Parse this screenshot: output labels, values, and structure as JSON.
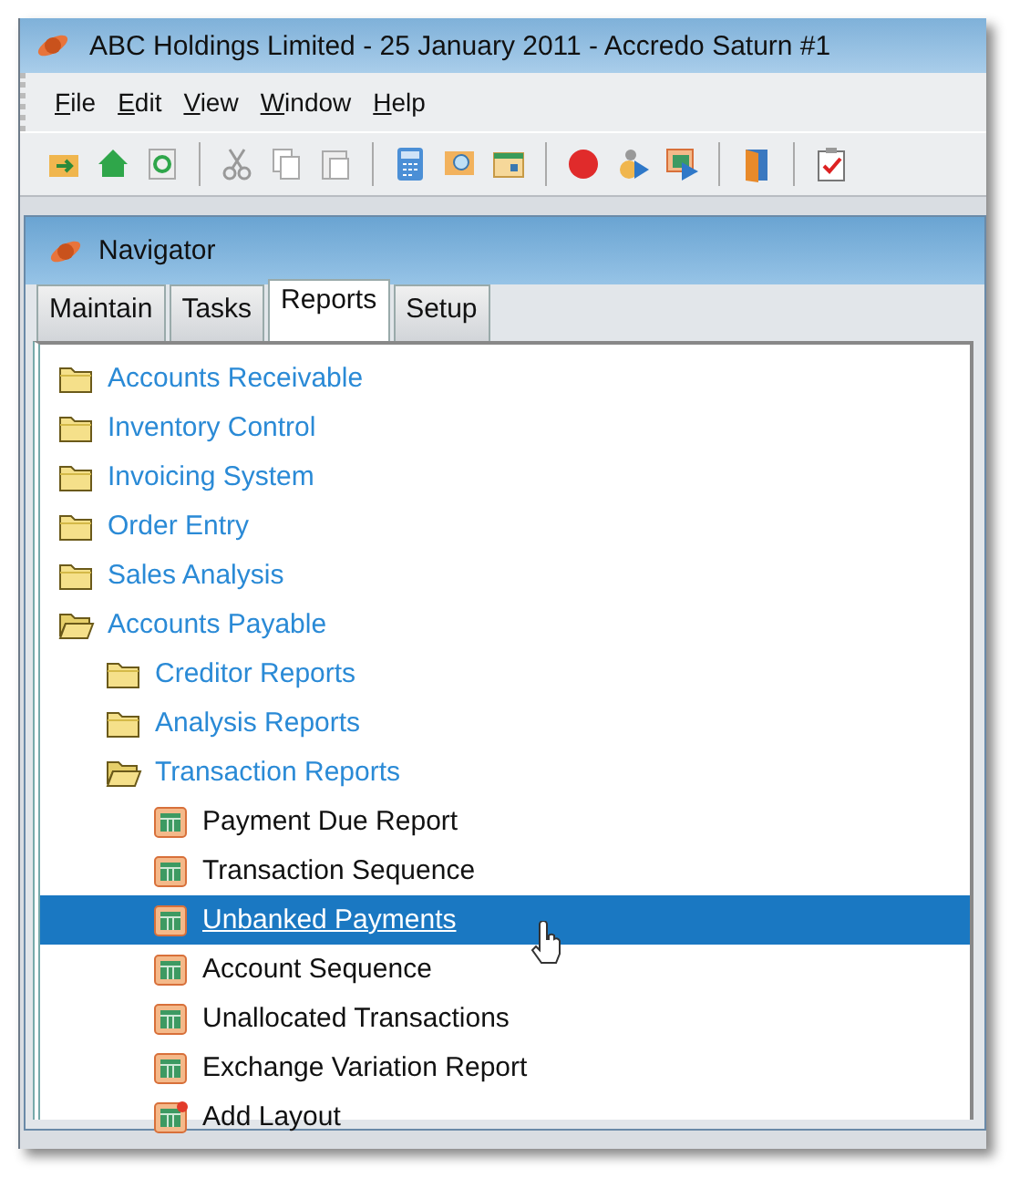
{
  "window": {
    "title": "ABC Holdings Limited - 25 January 2011 - Accredo Saturn #1"
  },
  "menu": [
    "File",
    "Edit",
    "View",
    "Window",
    "Help"
  ],
  "navigator": {
    "title": "Navigator",
    "tabs": [
      {
        "label": "Maintain",
        "selected": false
      },
      {
        "label": "Tasks",
        "selected": false
      },
      {
        "label": "Reports",
        "selected": true
      },
      {
        "label": "Setup",
        "selected": false
      }
    ],
    "tree": [
      {
        "label": "Accounts Receivable",
        "kind": "folder",
        "expanded": false,
        "selected": false
      },
      {
        "label": "Inventory Control",
        "kind": "folder",
        "expanded": false,
        "selected": false
      },
      {
        "label": "Invoicing System",
        "kind": "folder",
        "expanded": false,
        "selected": false
      },
      {
        "label": "Order Entry",
        "kind": "folder",
        "expanded": false,
        "selected": false
      },
      {
        "label": "Sales Analysis",
        "kind": "folder",
        "expanded": false,
        "selected": false
      },
      {
        "label": "Accounts Payable",
        "kind": "folder",
        "expanded": true,
        "selected": false,
        "children": [
          {
            "label": "Creditor Reports",
            "kind": "folder",
            "expanded": false,
            "selected": false
          },
          {
            "label": "Analysis Reports",
            "kind": "folder",
            "expanded": false,
            "selected": false
          },
          {
            "label": "Transaction Reports",
            "kind": "folder",
            "expanded": true,
            "selected": false,
            "children": [
              {
                "label": "Payment Due Report",
                "kind": "report",
                "selected": false
              },
              {
                "label": "Transaction Sequence",
                "kind": "report",
                "selected": false
              },
              {
                "label": "Unbanked Payments",
                "kind": "report",
                "selected": true
              },
              {
                "label": "Account Sequence",
                "kind": "report",
                "selected": false
              },
              {
                "label": "Unallocated Transactions",
                "kind": "report",
                "selected": false
              },
              {
                "label": "Exchange Variation Report",
                "kind": "report",
                "selected": false
              },
              {
                "label": "Add Layout",
                "kind": "add",
                "selected": false
              }
            ]
          }
        ]
      }
    ]
  }
}
